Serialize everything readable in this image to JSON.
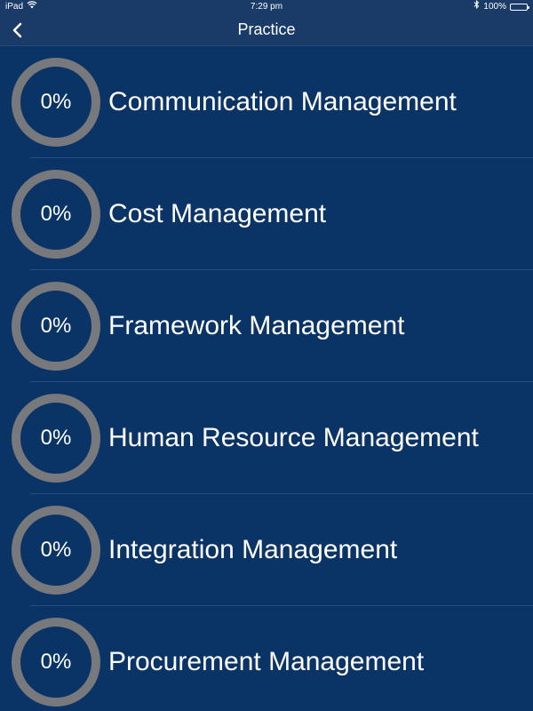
{
  "status_bar": {
    "device": "iPad",
    "time": "7:29 pm",
    "battery_text": "100%",
    "battery_color": "#4cd964"
  },
  "nav": {
    "title": "Practice",
    "back_icon": "chevron-left-icon"
  },
  "topics": [
    {
      "name": "Communication Management",
      "percent": "0%"
    },
    {
      "name": "Cost Management",
      "percent": "0%"
    },
    {
      "name": "Framework Management",
      "percent": "0%"
    },
    {
      "name": "Human Resource Management",
      "percent": "0%"
    },
    {
      "name": "Integration Management",
      "percent": "0%"
    },
    {
      "name": "Procurement Management",
      "percent": "0%"
    }
  ],
  "colors": {
    "background": "#0b3466",
    "bar": "#1a3b67",
    "ring": "#77797c"
  }
}
